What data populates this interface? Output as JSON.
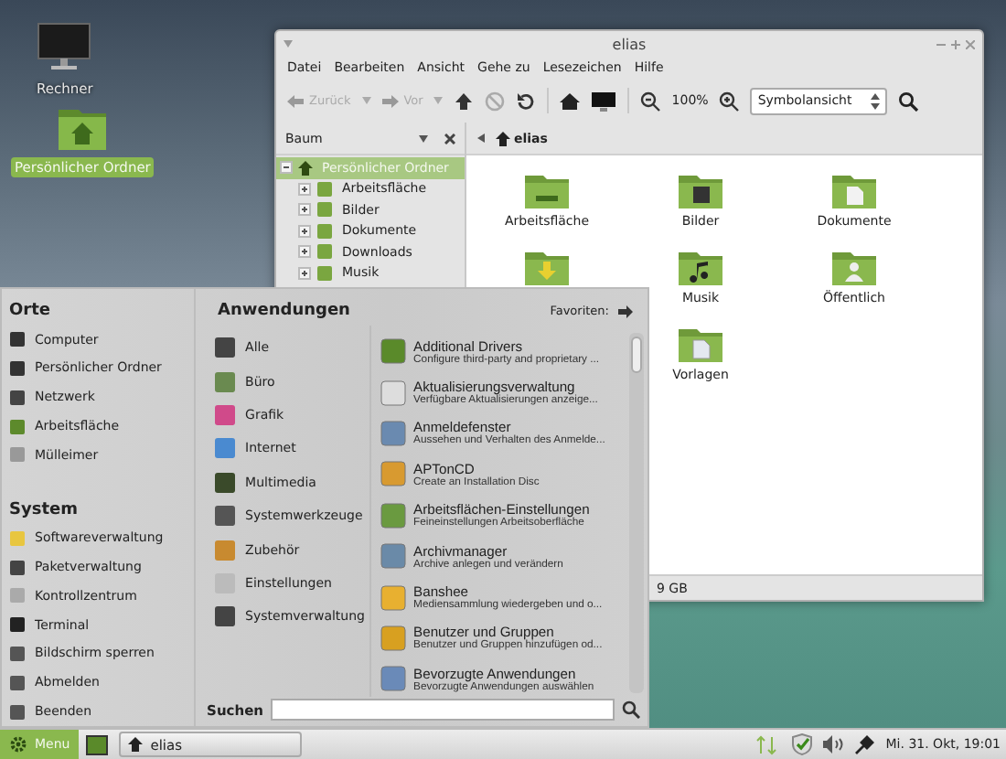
{
  "desktop_icons": [
    {
      "label": "Rechner",
      "kind": "monitor",
      "selected": false
    },
    {
      "label": "Persönlicher Ordner",
      "kind": "home",
      "selected": true
    }
  ],
  "window": {
    "title": "elias",
    "menu": [
      "Datei",
      "Bearbeiten",
      "Ansicht",
      "Gehe zu",
      "Lesezeichen",
      "Hilfe"
    ],
    "toolbar": {
      "back": "Zurück",
      "forward": "Vor",
      "zoom": "100%",
      "view": "Symbolansicht"
    },
    "sidebar": {
      "title": "Baum",
      "tree": [
        {
          "label": "Persönlicher Ordner",
          "selected": true,
          "expanded": true,
          "children": [
            {
              "label": "Arbeitsfläche",
              "selected": false,
              "expanded": false
            },
            {
              "label": "Bilder",
              "selected": false,
              "expanded": false
            },
            {
              "label": "Dokumente",
              "selected": false,
              "expanded": false
            },
            {
              "label": "Downloads",
              "selected": false,
              "expanded": false
            },
            {
              "label": "Musik",
              "selected": false,
              "expanded": false
            }
          ]
        }
      ]
    },
    "location": "elias",
    "files": [
      {
        "label": "Arbeitsfläche",
        "kind": "desktop"
      },
      {
        "label": "Bilder",
        "kind": "pictures"
      },
      {
        "label": "Dokumente",
        "kind": "documents"
      },
      {
        "kind": "downloads"
      },
      {
        "label": "Musik",
        "kind": "music"
      },
      {
        "label": "Öffentlich",
        "kind": "public"
      },
      {
        "label": "Vorlagen",
        "kind": "templates"
      }
    ],
    "status": "9 GB"
  },
  "menu": {
    "places_title": "Orte",
    "places": [
      "Computer",
      "Persönlicher Ordner",
      "Netzwerk",
      "Arbeitsfläche",
      "Mülleimer"
    ],
    "system_title": "System",
    "system": [
      "Softwareverwaltung",
      "Paketverwaltung",
      "Kontrollzentrum",
      "Terminal",
      "Bildschirm sperren",
      "Abmelden",
      "Beenden"
    ],
    "apps_title": "Anwendungen",
    "favorites": "Favoriten:",
    "categories": [
      "Alle",
      "Büro",
      "Grafik",
      "Internet",
      "Multimedia",
      "Systemwerkzeuge",
      "Zubehör",
      "Einstellungen",
      "Systemverwaltung"
    ],
    "applications": [
      {
        "name": "Additional Drivers",
        "description": "Configure third-party and proprietary ..."
      },
      {
        "name": "Aktualisierungsverwaltung",
        "description": "Verfügbare Aktualisierungen anzeige..."
      },
      {
        "name": "Anmeldefenster",
        "description": "Aussehen und Verhalten des Anmelde..."
      },
      {
        "name": "APTonCD",
        "description": "Create an Installation Disc"
      },
      {
        "name": "Arbeitsflächen-Einstellungen",
        "description": "Feineinstellungen Arbeitsoberfläche"
      },
      {
        "name": "Archivmanager",
        "description": "Archive anlegen und verändern"
      },
      {
        "name": "Banshee",
        "description": "Mediensammlung wiedergeben und o..."
      },
      {
        "name": "Benutzer und Gruppen",
        "description": "Benutzer und Gruppen hinzufügen od..."
      },
      {
        "name": "Bevorzugte Anwendungen",
        "description": "Bevorzugte Anwendungen auswählen"
      }
    ],
    "search_label": "Suchen"
  },
  "taskbar": {
    "menu": "Menu",
    "window": "elias",
    "clock": "Mi. 31. Okt, 19:01"
  }
}
